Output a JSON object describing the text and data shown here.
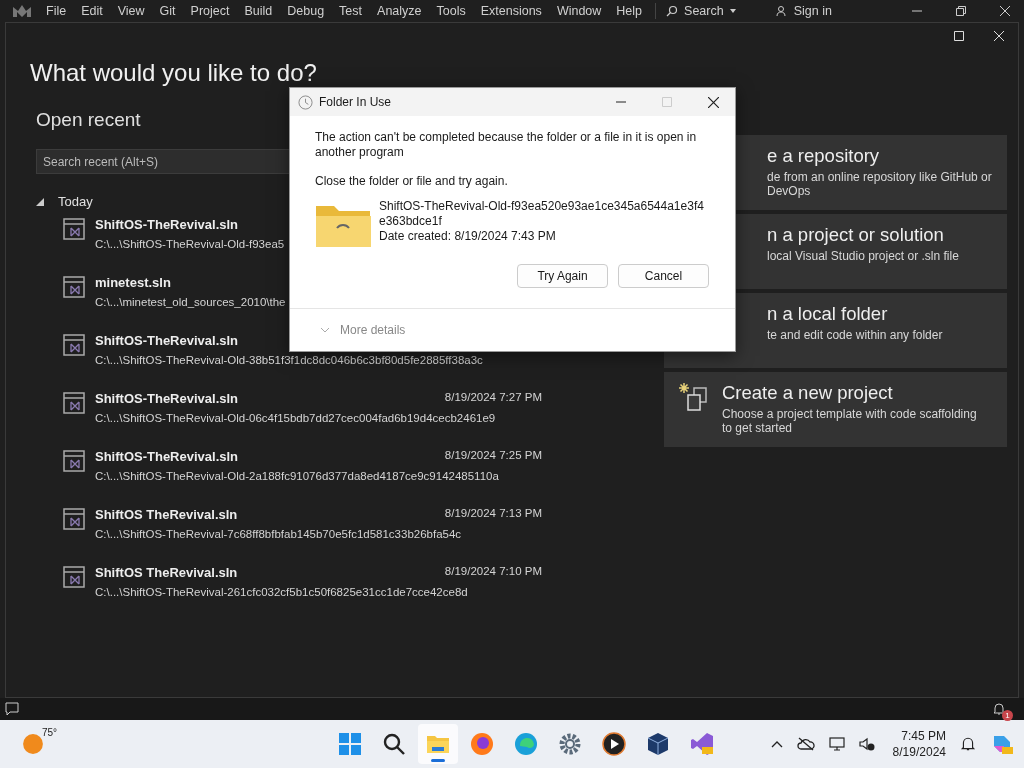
{
  "menu": [
    "File",
    "Edit",
    "View",
    "Git",
    "Project",
    "Build",
    "Debug",
    "Test",
    "Analyze",
    "Tools",
    "Extensions",
    "Window",
    "Help"
  ],
  "search": "Search",
  "sign_in": "Sign in",
  "start": {
    "title": "What would you like to do?",
    "recent_heading": "Open recent",
    "search_placeholder": "Search recent (Alt+S)",
    "group": {
      "label": "Today",
      "expanded": true,
      "items": [
        {
          "name": "ShiftOS-TheRevival.sln",
          "path": "C:\\...\\ShiftOS-TheRevival-Old-f93ea5"
        },
        {
          "name": "minetest.sln",
          "path": "C:\\...\\minetest_old_sources_2010\\the"
        },
        {
          "name": "ShiftOS-TheRevival.sln",
          "path": "C:\\...\\ShiftOS-TheRevival-Old-38b51f3f1dc8dc046b6c3bf80d5fe2885ff38a3c"
        },
        {
          "name": "ShiftOS-TheRevival.sln",
          "date": "8/19/2024 7:27 PM",
          "path": "C:\\...\\ShiftOS-TheRevival-Old-06c4f15bdb7dd27cec004fad6b19d4cecb2461e9"
        },
        {
          "name": "ShiftOS-TheRevival.sln",
          "date": "8/19/2024 7:25 PM",
          "path": "C:\\...\\ShiftOS-TheRevival-Old-2a188fc91076d377da8ed4187ce9c9142485110a"
        },
        {
          "name": "ShiftOS TheRevival.sln",
          "date": "8/19/2024 7:13 PM",
          "path": "C:\\...\\ShiftOS-TheRevival-7c68ff8bfbfab145b70e5fc1d581c33b26bfa54c"
        },
        {
          "name": "ShiftOS TheRevival.sln",
          "date": "8/19/2024 7:10 PM",
          "path": "C:\\...\\ShiftOS-TheRevival-261cfc032cf5b1c50f6825e31cc1de7cce42ce8d"
        }
      ]
    },
    "actions": [
      {
        "kind": "covered",
        "title": "e a repository",
        "lines": [
          "de from an online repository like GitHub or",
          "DevOps"
        ]
      },
      {
        "kind": "covered",
        "title": "n a project or solution",
        "lines": [
          "local Visual Studio project or .sln file"
        ]
      },
      {
        "kind": "covered",
        "title": "n a local folder",
        "lines": [
          "te and edit code within any folder"
        ]
      },
      {
        "kind": "new",
        "title": "Create a new project",
        "lines": [
          "Choose a project template with code scaffolding",
          "to get started"
        ]
      }
    ]
  },
  "dialog": {
    "title": "Folder In Use",
    "message": "The action can't be completed because the folder or a file in it is open in another program",
    "instruction": "Close the folder or file and try again.",
    "file_name": "ShiftOS-TheRevival-Old-f93ea520e93ae1ce345a6544a1e3f4e363bdce1f",
    "date_created": "Date created: 8/19/2024 7:43 PM",
    "buttons": [
      "Try Again",
      "Cancel"
    ],
    "more_details": "More details"
  },
  "status_bar": {
    "notifications": "1"
  },
  "taskbar": {
    "weather": "75°",
    "apps": [
      {
        "kind": "start",
        "selected": false
      },
      {
        "kind": "search",
        "selected": false
      },
      {
        "kind": "explorer",
        "selected": true
      },
      {
        "kind": "firefox",
        "selected": false
      },
      {
        "kind": "edge",
        "selected": false
      },
      {
        "kind": "settings",
        "selected": false
      },
      {
        "kind": "player",
        "selected": false
      },
      {
        "kind": "box",
        "selected": false
      },
      {
        "kind": "vs",
        "selected": false
      }
    ],
    "time": "7:45 PM",
    "date": "8/19/2024"
  }
}
